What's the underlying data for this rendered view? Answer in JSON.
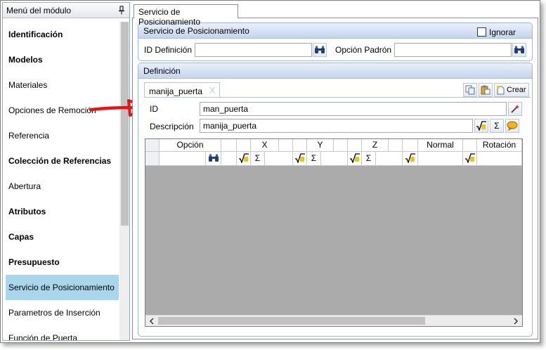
{
  "left_panel": {
    "title": "Menú del módulo",
    "items": [
      {
        "label": "Identificación",
        "bold": true,
        "selected": false
      },
      {
        "label": "Modelos",
        "bold": true,
        "selected": false
      },
      {
        "label": "Materiales",
        "bold": false,
        "selected": false
      },
      {
        "label": "Opciones de Remoción",
        "bold": false,
        "selected": false
      },
      {
        "label": "Referencia",
        "bold": false,
        "selected": false
      },
      {
        "label": "Colección de Referencias",
        "bold": true,
        "selected": false
      },
      {
        "label": "Abertura",
        "bold": false,
        "selected": false
      },
      {
        "label": "Atributos",
        "bold": true,
        "selected": false
      },
      {
        "label": "Capas",
        "bold": true,
        "selected": false
      },
      {
        "label": "Presupuesto",
        "bold": true,
        "selected": false
      },
      {
        "label": "Servicio de Posicionamiento",
        "bold": false,
        "selected": true
      },
      {
        "label": "Parametros de Inserción",
        "bold": false,
        "selected": false
      },
      {
        "label": "Función de Puerta",
        "bold": false,
        "selected": false
      }
    ]
  },
  "document_tab": "Servicio de Posicionamiento",
  "service_group": {
    "title": "Servicio de Posicionamiento",
    "ignore_label": "Ignorar",
    "id_label": "ID Definición",
    "id_value": "",
    "option_label": "Opción Padrón",
    "option_value": ""
  },
  "definition_group": {
    "title": "Definición",
    "tab_label": "manija_puerta",
    "tab_close": "X",
    "create_label": "Crear",
    "id_label": "ID",
    "id_value": "man_puerta",
    "desc_label": "Descripción",
    "desc_value": "manija_puerta"
  },
  "grid": {
    "columns": [
      "Opción",
      "X",
      "Y",
      "Z",
      "Normal",
      "Rotación"
    ],
    "sigma": "Σ"
  },
  "colors": {
    "selected_item": "#a9d6ea",
    "group_header": "#c4d5ee",
    "arrow": "#ee1111",
    "grid_bg": "#ababab"
  }
}
